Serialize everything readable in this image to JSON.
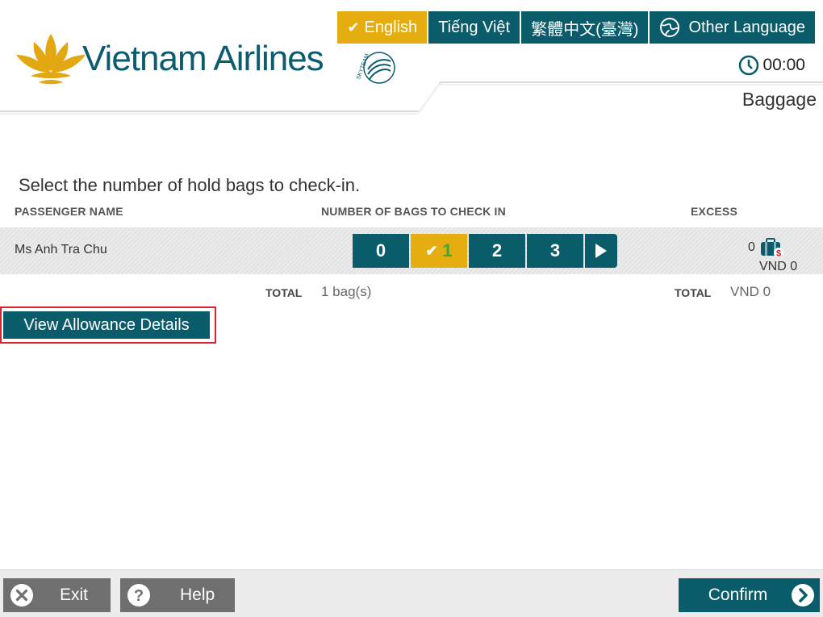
{
  "brand": {
    "name": "Vietnam Airlines",
    "alliance_text": "SKYTEAM",
    "color_primary": "#0b5c6b",
    "color_accent": "#e6ad10"
  },
  "languages": [
    {
      "label": "English",
      "active": true
    },
    {
      "label": "Tiếng Việt",
      "active": false
    },
    {
      "label": "繁體中文(臺灣)",
      "active": false
    },
    {
      "label": "Other Language",
      "active": false,
      "icon": "globe-icon"
    }
  ],
  "timer": {
    "icon": "clock-icon",
    "value": "00:00"
  },
  "page": {
    "title": "Baggage"
  },
  "main": {
    "instruction": "Select the number of hold bags to check-in.",
    "columns": {
      "passenger": "PASSENGER NAME",
      "bags": "NUMBER OF BAGS TO CHECK IN",
      "excess": "EXCESS"
    },
    "passenger": {
      "name": "Ms Anh Tra Chu",
      "bag_options": [
        "0",
        "1",
        "2",
        "3"
      ],
      "selected": "1",
      "excess_count": "0",
      "excess_amount": "VND 0"
    },
    "totals": {
      "label": "TOTAL",
      "bags": "1 bag(s)",
      "excess_label": "TOTAL",
      "excess": "VND 0"
    },
    "allowance_button": "View Allowance Details"
  },
  "footer": {
    "exit": "Exit",
    "help": "Help",
    "confirm": "Confirm"
  }
}
